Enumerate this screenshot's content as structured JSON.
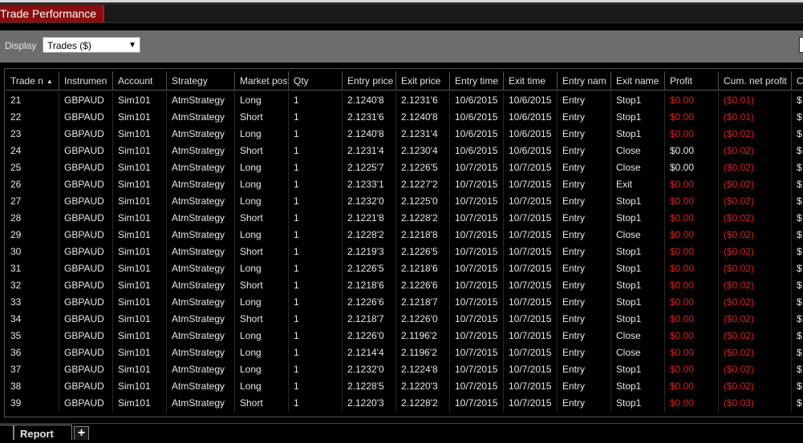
{
  "window": {
    "title": "Trade Performance"
  },
  "toolbar": {
    "display_label": "Display",
    "display_value": "Trades ($)"
  },
  "columns": [
    "Trade n",
    "Instrumen",
    "Account",
    "Strategy",
    "Market pos",
    "Qty",
    "Entry price",
    "Exit price",
    "Entry time",
    "Exit time",
    "Entry nam",
    "Exit name",
    "Profit",
    "Cum. net profit",
    "C"
  ],
  "rows": [
    [
      "21",
      "GBPAUD",
      "Sim101",
      "AtmStrategy",
      "Long",
      "1",
      "2.1240'8",
      "2.1231'6",
      "10/6/2015",
      "10/6/2015",
      "Entry",
      "Stop1",
      "$0.00",
      "($0.01)",
      "$"
    ],
    [
      "22",
      "GBPAUD",
      "Sim101",
      "AtmStrategy",
      "Short",
      "1",
      "2.1231'6",
      "2.1240'8",
      "10/6/2015",
      "10/6/2015",
      "Entry",
      "Stop1",
      "$0.00",
      "($0.01)",
      "$"
    ],
    [
      "23",
      "GBPAUD",
      "Sim101",
      "AtmStrategy",
      "Long",
      "1",
      "2.1240'8",
      "2.1231'4",
      "10/6/2015",
      "10/6/2015",
      "Entry",
      "Stop1",
      "$0.00",
      "($0.02)",
      "$"
    ],
    [
      "24",
      "GBPAUD",
      "Sim101",
      "AtmStrategy",
      "Short",
      "1",
      "2.1231'4",
      "2.1230'4",
      "10/6/2015",
      "10/6/2015",
      "Entry",
      "Close",
      "$0.00",
      "($0.02)",
      "$"
    ],
    [
      "25",
      "GBPAUD",
      "Sim101",
      "AtmStrategy",
      "Long",
      "1",
      "2.1225'7",
      "2.1226'5",
      "10/7/2015",
      "10/7/2015",
      "Entry",
      "Close",
      "$0.00",
      "($0.02)",
      "$"
    ],
    [
      "26",
      "GBPAUD",
      "Sim101",
      "AtmStrategy",
      "Long",
      "1",
      "2.1233'1",
      "2.1227'2",
      "10/7/2015",
      "10/7/2015",
      "Entry",
      "Exit",
      "$0.00",
      "($0.02)",
      "$"
    ],
    [
      "27",
      "GBPAUD",
      "Sim101",
      "AtmStrategy",
      "Long",
      "1",
      "2.1232'0",
      "2.1225'0",
      "10/7/2015",
      "10/7/2015",
      "Entry",
      "Stop1",
      "$0.00",
      "($0.02)",
      "$"
    ],
    [
      "28",
      "GBPAUD",
      "Sim101",
      "AtmStrategy",
      "Short",
      "1",
      "2.1221'8",
      "2.1228'2",
      "10/7/2015",
      "10/7/2015",
      "Entry",
      "Stop1",
      "$0.00",
      "($0.02)",
      "$"
    ],
    [
      "29",
      "GBPAUD",
      "Sim101",
      "AtmStrategy",
      "Long",
      "1",
      "2.1228'2",
      "2.1218'8",
      "10/7/2015",
      "10/7/2015",
      "Entry",
      "Close",
      "$0.00",
      "($0.02)",
      "$"
    ],
    [
      "30",
      "GBPAUD",
      "Sim101",
      "AtmStrategy",
      "Short",
      "1",
      "2.1219'3",
      "2.1226'5",
      "10/7/2015",
      "10/7/2015",
      "Entry",
      "Stop1",
      "$0.00",
      "($0.02)",
      "$"
    ],
    [
      "31",
      "GBPAUD",
      "Sim101",
      "AtmStrategy",
      "Long",
      "1",
      "2.1226'5",
      "2.1218'6",
      "10/7/2015",
      "10/7/2015",
      "Entry",
      "Stop1",
      "$0.00",
      "($0.02)",
      "$"
    ],
    [
      "32",
      "GBPAUD",
      "Sim101",
      "AtmStrategy",
      "Short",
      "1",
      "2.1218'6",
      "2.1226'6",
      "10/7/2015",
      "10/7/2015",
      "Entry",
      "Stop1",
      "$0.00",
      "($0.02)",
      "$"
    ],
    [
      "33",
      "GBPAUD",
      "Sim101",
      "AtmStrategy",
      "Long",
      "1",
      "2.1226'6",
      "2.1218'7",
      "10/7/2015",
      "10/7/2015",
      "Entry",
      "Stop1",
      "$0.00",
      "($0.02)",
      "$"
    ],
    [
      "34",
      "GBPAUD",
      "Sim101",
      "AtmStrategy",
      "Short",
      "1",
      "2.1218'7",
      "2.1226'0",
      "10/7/2015",
      "10/7/2015",
      "Entry",
      "Stop1",
      "$0.00",
      "($0.02)",
      "$"
    ],
    [
      "35",
      "GBPAUD",
      "Sim101",
      "AtmStrategy",
      "Long",
      "1",
      "2.1226'0",
      "2.1196'2",
      "10/7/2015",
      "10/7/2015",
      "Entry",
      "Close",
      "$0.00",
      "($0.02)",
      "$"
    ],
    [
      "36",
      "GBPAUD",
      "Sim101",
      "AtmStrategy",
      "Long",
      "1",
      "2.1214'4",
      "2.1196'2",
      "10/7/2015",
      "10/7/2015",
      "Entry",
      "Close",
      "$0.00",
      "($0.02)",
      "$"
    ],
    [
      "37",
      "GBPAUD",
      "Sim101",
      "AtmStrategy",
      "Long",
      "1",
      "2.1232'0",
      "2.1224'8",
      "10/7/2015",
      "10/7/2015",
      "Entry",
      "Stop1",
      "$0.00",
      "($0.02)",
      "$"
    ],
    [
      "38",
      "GBPAUD",
      "Sim101",
      "AtmStrategy",
      "Long",
      "1",
      "2.1228'5",
      "2.1220'3",
      "10/7/2015",
      "10/7/2015",
      "Entry",
      "Stop1",
      "$0.00",
      "($0.02)",
      "$"
    ],
    [
      "39",
      "GBPAUD",
      "Sim101",
      "AtmStrategy",
      "Short",
      "1",
      "2.1220'3",
      "2.1228'2",
      "10/7/2015",
      "10/7/2015",
      "Entry",
      "Stop1",
      "$0.00",
      "($0.03)",
      "$"
    ]
  ],
  "red_profit_rows": [
    "21",
    "22",
    "23",
    "26",
    "27",
    "28",
    "29",
    "30",
    "31",
    "32",
    "33",
    "34",
    "35",
    "36",
    "37",
    "38",
    "39"
  ],
  "colors": {
    "loss": "#e01c1c",
    "title_tab": "#8a0d0d",
    "toolbar": "#6d6d6d"
  },
  "tabs": {
    "report_label": "Report",
    "add_label": "+"
  }
}
